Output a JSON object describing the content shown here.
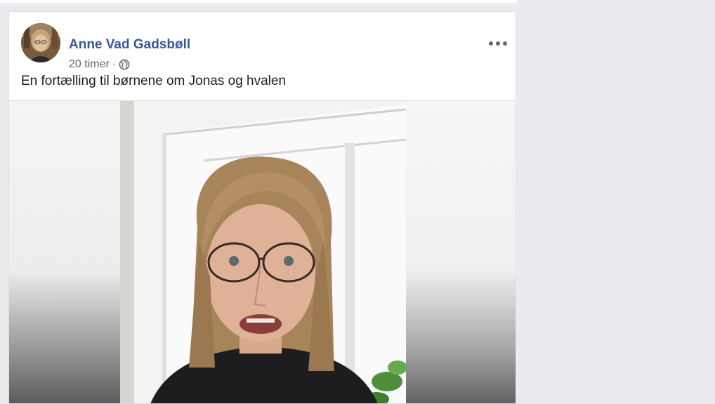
{
  "post": {
    "author_name": "Anne Vad Gadsbøll",
    "timestamp": "20 timer",
    "separator": "·",
    "privacy_icon": "globe-icon",
    "more_icon": "more-options-icon",
    "text": "En fortælling til børnene om Jonas og hvalen"
  },
  "video": {
    "content": "woman-with-glasses-speaking"
  },
  "colors": {
    "link": "#385898",
    "secondary_text": "#606770",
    "primary_text": "#1c1e21",
    "page_background": "#e9ebee"
  }
}
